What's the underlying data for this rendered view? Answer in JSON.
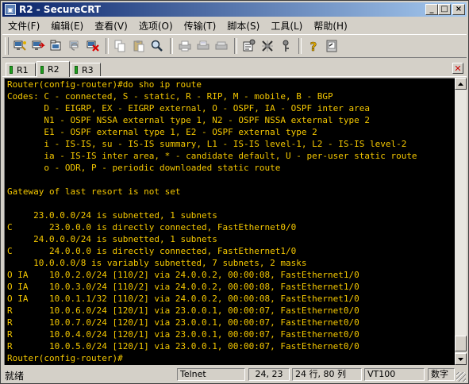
{
  "window": {
    "title": "R2 - SecureCRT",
    "controls": {
      "minimize": "_",
      "maximize": "□",
      "close": "×"
    }
  },
  "menu": [
    {
      "label": "文件(F)"
    },
    {
      "label": "编辑(E)"
    },
    {
      "label": "查看(V)"
    },
    {
      "label": "选项(O)"
    },
    {
      "label": "传输(T)"
    },
    {
      "label": "脚本(S)"
    },
    {
      "label": "工具(L)"
    },
    {
      "label": "帮助(H)"
    }
  ],
  "toolbar_icons": [
    "connect-icon",
    "quick-connect-icon",
    "connect-in-tab-icon",
    "reconnect-icon",
    "disconnect-icon",
    "copy-icon",
    "paste-icon",
    "find-icon",
    "print-icon",
    "print-selection-icon",
    "print-setup-icon",
    "session-options-icon",
    "global-options-icon",
    "keymap-icon",
    "help-icon",
    "keyboard-icon"
  ],
  "tabs": [
    {
      "label": "R1",
      "active": false
    },
    {
      "label": "R2",
      "active": true
    },
    {
      "label": "R3",
      "active": false
    }
  ],
  "terminal": {
    "text_color": "#f5c800",
    "background": "#000000",
    "lines": [
      "Router(config-router)#do sho ip route",
      "Codes: C - connected, S - static, R - RIP, M - mobile, B - BGP",
      "       D - EIGRP, EX - EIGRP external, O - OSPF, IA - OSPF inter area",
      "       N1 - OSPF NSSA external type 1, N2 - OSPF NSSA external type 2",
      "       E1 - OSPF external type 1, E2 - OSPF external type 2",
      "       i - IS-IS, su - IS-IS summary, L1 - IS-IS level-1, L2 - IS-IS level-2",
      "       ia - IS-IS inter area, * - candidate default, U - per-user static route",
      "       o - ODR, P - periodic downloaded static route",
      "",
      "Gateway of last resort is not set",
      "",
      "     23.0.0.0/24 is subnetted, 1 subnets",
      "C       23.0.0.0 is directly connected, FastEthernet0/0",
      "     24.0.0.0/24 is subnetted, 1 subnets",
      "C       24.0.0.0 is directly connected, FastEthernet1/0",
      "     10.0.0.0/8 is variably subnetted, 7 subnets, 2 masks",
      "O IA    10.0.2.0/24 [110/2] via 24.0.0.2, 00:00:08, FastEthernet1/0",
      "O IA    10.0.3.0/24 [110/2] via 24.0.0.2, 00:00:08, FastEthernet1/0",
      "O IA    10.0.1.1/32 [110/2] via 24.0.0.2, 00:00:08, FastEthernet1/0",
      "R       10.0.6.0/24 [120/1] via 23.0.0.1, 00:00:07, FastEthernet0/0",
      "R       10.0.7.0/24 [120/1] via 23.0.0.1, 00:00:07, FastEthernet0/0",
      "R       10.0.4.0/24 [120/1] via 23.0.0.1, 00:00:07, FastEthernet0/0",
      "R       10.0.5.0/24 [120/1] via 23.0.0.1, 00:00:07, FastEthernet0/0",
      "Router(config-router)#"
    ]
  },
  "statusbar": {
    "ready": "就绪",
    "protocol": "Telnet",
    "cursor": "24, 23",
    "size": "24 行, 80 列",
    "emulation": "VT100",
    "numlock": "数字"
  }
}
